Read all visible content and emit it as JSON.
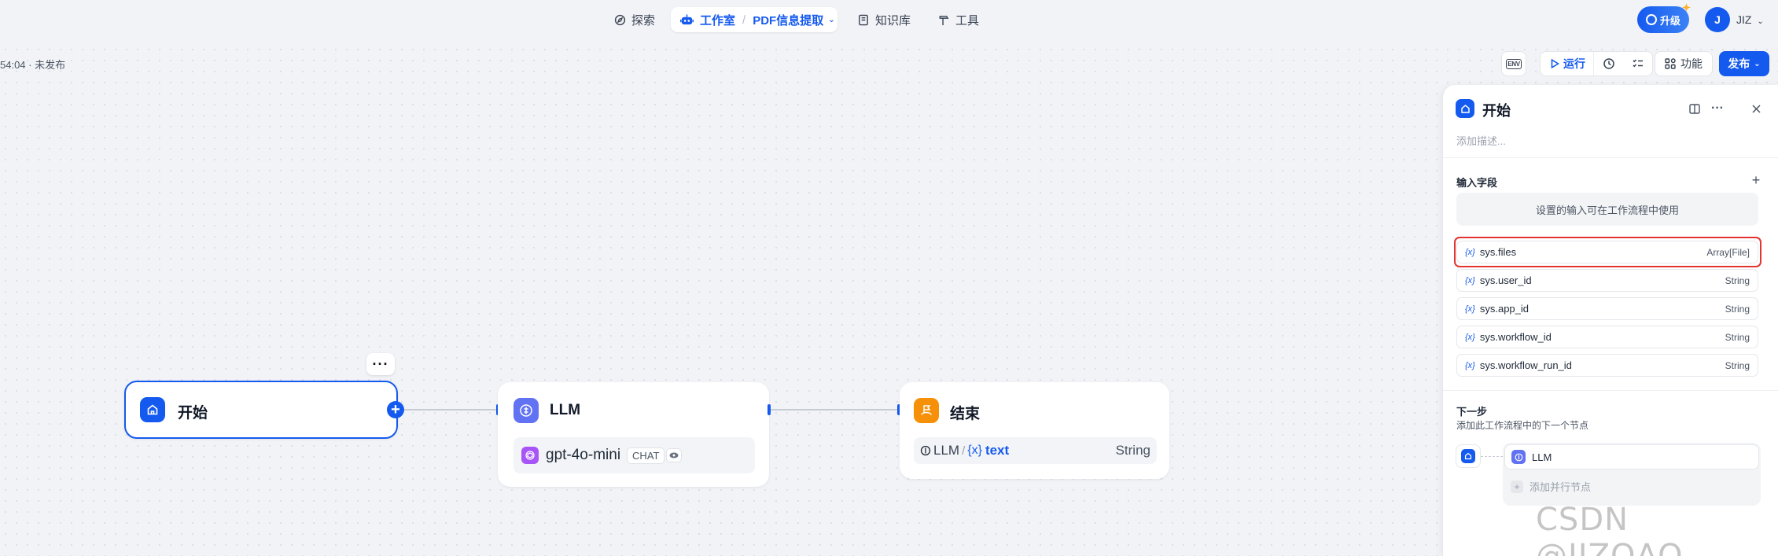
{
  "nav": {
    "explore": "探索",
    "studio": "工作室",
    "app_name": "PDF信息提取",
    "knowledge": "知识库",
    "tools": "工具"
  },
  "account": {
    "upgrade": "升级",
    "avatar_initial": "J",
    "username": "JIZ"
  },
  "status": {
    "saved": "54:04 · 未发布"
  },
  "toolbar": {
    "env": "ENV",
    "run": "运行",
    "features": "功能",
    "publish": "发布"
  },
  "nodes": {
    "start": {
      "title": "开始"
    },
    "llm": {
      "title": "LLM",
      "model": "gpt-4o-mini",
      "mode": "CHAT"
    },
    "end": {
      "title": "结束",
      "var_source": "LLM",
      "var_sep": "/",
      "var_prefix": "{x}",
      "var_name": "text",
      "var_type": "String"
    }
  },
  "panel": {
    "title": "开始",
    "description_placeholder": "添加描述...",
    "inputs_label": "输入字段",
    "inputs_hint": "设置的输入可在工作流程中使用",
    "variables": [
      {
        "name": "sys.files",
        "type": "Array[File]"
      },
      {
        "name": "sys.user_id",
        "type": "String"
      },
      {
        "name": "sys.app_id",
        "type": "String"
      },
      {
        "name": "sys.workflow_id",
        "type": "String"
      },
      {
        "name": "sys.workflow_run_id",
        "type": "String"
      }
    ],
    "var_prefix": "{x}",
    "next_label": "下一步",
    "next_hint": "添加此工作流程中的下一个节点",
    "next_node": "LLM",
    "add_parallel": "添加并行节点"
  },
  "watermark": "CSDN @JIZQAQ",
  "colors": {
    "accent": "#155aef",
    "end_node": "#f79009",
    "llm_node": "#6172f3",
    "highlight": "#e3342f"
  }
}
